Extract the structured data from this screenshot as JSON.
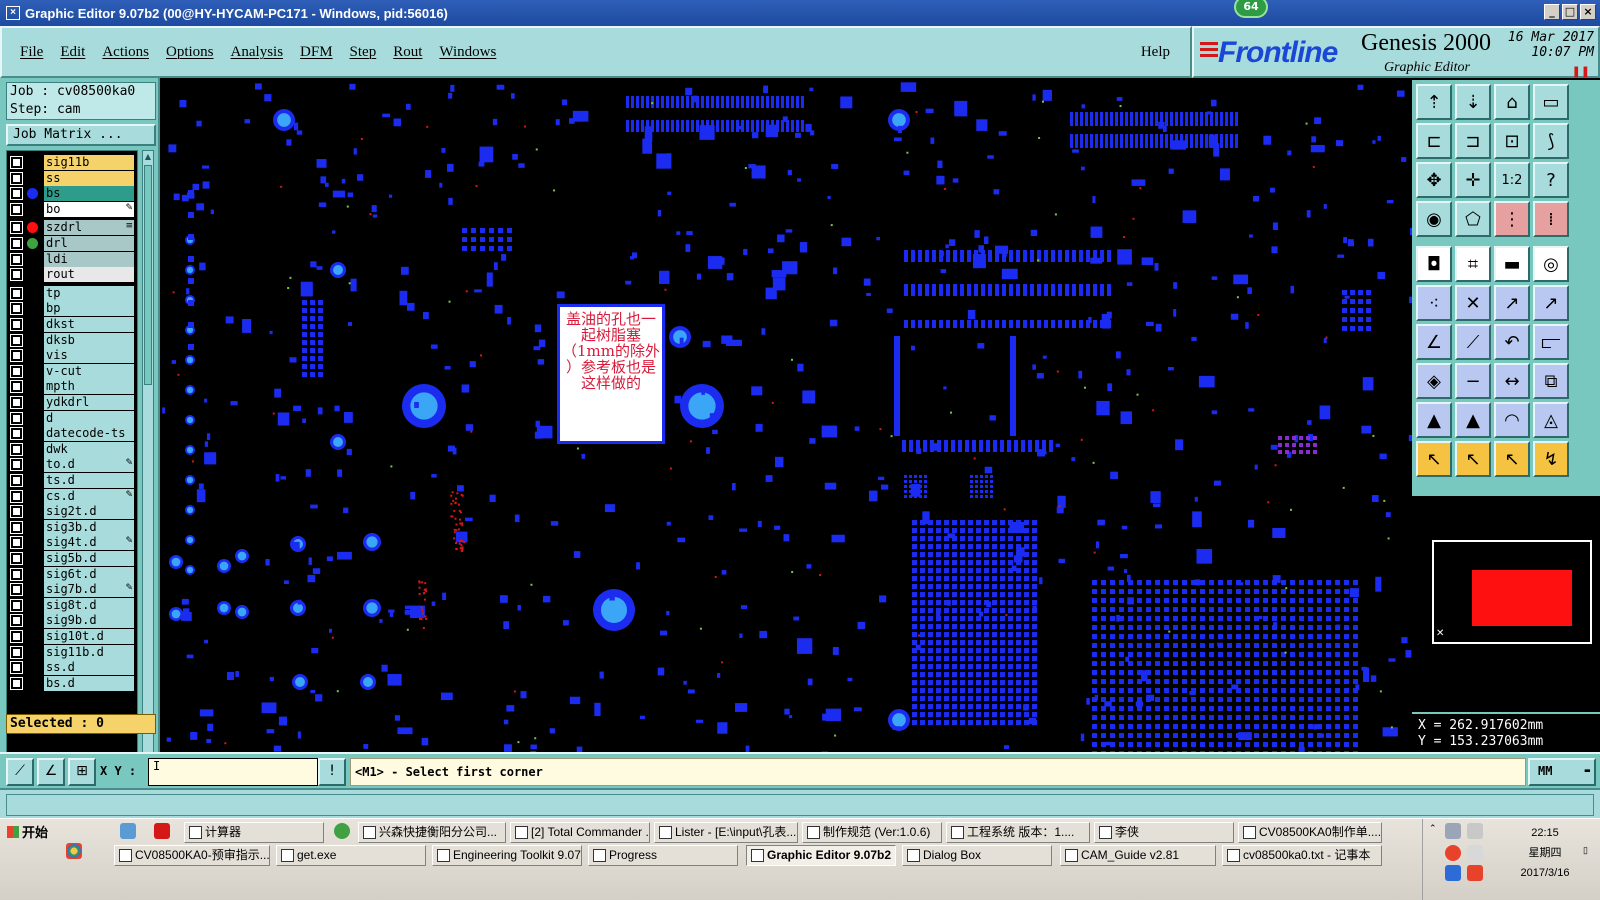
{
  "window": {
    "title": "Graphic Editor 9.07b2 (00@HY-HYCAM-PC171 - Windows, pid:56016)",
    "badge": "64"
  },
  "menu": {
    "items": [
      "File",
      "Edit",
      "Actions",
      "Options",
      "Analysis",
      "DFM",
      "Step",
      "Rout",
      "Windows"
    ],
    "help": "Help"
  },
  "brand": {
    "logo": "Frontline",
    "product": "Genesis 2000",
    "subtitle": "Graphic Editor",
    "date": "16 Mar 2017",
    "time": "10:07 PM",
    "pause_icon": "pause-icon"
  },
  "job": {
    "job_line": "Job : cv08500ka0",
    "step_line": "Step: cam",
    "matrix_button": "Job Matrix ..."
  },
  "layers": [
    {
      "name": "sig11b",
      "color": "#f5d36a",
      "dot": "",
      "flag": ""
    },
    {
      "name": "ss",
      "color": "#f5d36a",
      "dot": "",
      "flag": ""
    },
    {
      "name": "bs",
      "color": "#2e9c8a",
      "dot": "#1b2cf0",
      "flag": ""
    },
    {
      "name": "bo",
      "color": "#ffffff",
      "dot": "",
      "flag": "✎"
    },
    {
      "name": "szdrl",
      "color": "#a8c8c8",
      "dot": "#ff1010",
      "flag": "≡"
    },
    {
      "name": "drl",
      "color": "#a8c8c8",
      "dot": "#3fa142",
      "flag": ""
    },
    {
      "name": "ldi",
      "color": "#a8c8c8",
      "dot": "",
      "flag": ""
    },
    {
      "name": "rout",
      "color": "#e8e8e8",
      "dot": "",
      "flag": ""
    },
    {
      "name": "tp",
      "color": "#a8dcdc",
      "dot": "",
      "flag": ""
    },
    {
      "name": "bp",
      "color": "#a8dcdc",
      "dot": "",
      "flag": ""
    },
    {
      "name": "dkst",
      "color": "#a8dcdc",
      "dot": "",
      "flag": ""
    },
    {
      "name": "dksb",
      "color": "#a8dcdc",
      "dot": "",
      "flag": ""
    },
    {
      "name": "vis",
      "color": "#a8dcdc",
      "dot": "",
      "flag": ""
    },
    {
      "name": "v-cut",
      "color": "#a8dcdc",
      "dot": "",
      "flag": ""
    },
    {
      "name": "mpth",
      "color": "#a8dcdc",
      "dot": "",
      "flag": ""
    },
    {
      "name": "ydkdrl",
      "color": "#a8dcdc",
      "dot": "",
      "flag": ""
    },
    {
      "name": "d",
      "color": "#a8dcdc",
      "dot": "",
      "flag": ""
    },
    {
      "name": "datecode-ts",
      "color": "#a8dcdc",
      "dot": "",
      "flag": ""
    },
    {
      "name": "dwk",
      "color": "#a8dcdc",
      "dot": "",
      "flag": ""
    },
    {
      "name": "to.d",
      "color": "#a8dcdc",
      "dot": "",
      "flag": "✎"
    },
    {
      "name": "ts.d",
      "color": "#a8dcdc",
      "dot": "",
      "flag": ""
    },
    {
      "name": "cs.d",
      "color": "#a8dcdc",
      "dot": "",
      "flag": "✎"
    },
    {
      "name": "sig2t.d",
      "color": "#a8dcdc",
      "dot": "",
      "flag": ""
    },
    {
      "name": "sig3b.d",
      "color": "#a8dcdc",
      "dot": "",
      "flag": ""
    },
    {
      "name": "sig4t.d",
      "color": "#a8dcdc",
      "dot": "",
      "flag": "✎"
    },
    {
      "name": "sig5b.d",
      "color": "#a8dcdc",
      "dot": "",
      "flag": ""
    },
    {
      "name": "sig6t.d",
      "color": "#a8dcdc",
      "dot": "",
      "flag": ""
    },
    {
      "name": "sig7b.d",
      "color": "#a8dcdc",
      "dot": "",
      "flag": "✎"
    },
    {
      "name": "sig8t.d",
      "color": "#a8dcdc",
      "dot": "",
      "flag": ""
    },
    {
      "name": "sig9b.d",
      "color": "#a8dcdc",
      "dot": "",
      "flag": ""
    },
    {
      "name": "sig10t.d",
      "color": "#a8dcdc",
      "dot": "",
      "flag": ""
    },
    {
      "name": "sig11b.d",
      "color": "#a8dcdc",
      "dot": "",
      "flag": ""
    },
    {
      "name": "ss.d",
      "color": "#a8dcdc",
      "dot": "",
      "flag": ""
    },
    {
      "name": "bs.d",
      "color": "#a8dcdc",
      "dot": "",
      "flag": ""
    }
  ],
  "selected": "Selected : 0",
  "canvas_note": {
    "lines": [
      "盖油的孔也一",
      "起树脂塞",
      "（1mm的除外",
      "）参考板也是",
      "这样做的"
    ]
  },
  "coords": {
    "x": "X = 262.917602mm",
    "y": "Y = 153.237063mm"
  },
  "command": {
    "xy_label": "X Y :",
    "xy_value": "I",
    "message": "<M1> - Select first corner",
    "unit": "MM",
    "info_icon": "!"
  },
  "right_tools": [
    "layer-up-icon",
    "layer-down-icon",
    "home-icon",
    "window-icon",
    "zoom-in-icon",
    "zoom-out-icon",
    "fit-icon",
    "snap-icon",
    "pan-icon",
    "center-icon",
    "scale-1-2-icon",
    "help-icon",
    "measure-icon",
    "probe-icon",
    "select-net-icon",
    "select-sym-icon",
    "camera-icon",
    "drc-icon",
    "ruler-icon",
    "target-icon",
    "connect-icon",
    "cut-icon",
    "line-icon",
    "move-icon",
    "draw-line-icon",
    "draw-slant-icon",
    "undo-icon",
    "split-icon",
    "pad-icon",
    "minus-icon",
    "dimension-icon",
    "array-icon",
    "text-icon",
    "arrow-up-icon",
    "arc-icon",
    "fillet-icon",
    "pointer-icon",
    "select-icon",
    "highlight-icon",
    "route-icon"
  ],
  "taskbar": {
    "start": "开始",
    "row1": [
      {
        "label": "计算器",
        "icon": "calc-icon"
      },
      {
        "label": "兴森快捷衡阳分公司...",
        "icon": "browser-icon"
      },
      {
        "label": "[2] Total Commander ...",
        "icon": "commander-icon"
      },
      {
        "label": "Lister - [E:\\input\\孔表...",
        "icon": "lister-icon"
      },
      {
        "label": "制作规范 (Ver:1.0.6)",
        "icon": "doc-icon"
      },
      {
        "label": "工程系统  版本：1....",
        "icon": "system-icon"
      },
      {
        "label": "李侠",
        "icon": "chat-icon"
      },
      {
        "label": "CV08500KA0制作单....",
        "icon": "form-icon"
      }
    ],
    "row2": [
      {
        "label": "CV08500KA0-预审指示....",
        "icon": "form-icon"
      },
      {
        "label": "get.exe",
        "icon": "exe-icon"
      },
      {
        "label": "Engineering Toolkit 9.07...",
        "icon": "toolkit-icon"
      },
      {
        "label": "Progress",
        "icon": "progress-icon"
      },
      {
        "label": "Graphic Editor 9.07b2 ...",
        "icon": "editor-icon",
        "active": true
      },
      {
        "label": "Dialog Box",
        "icon": "dialog-icon"
      },
      {
        "label": "CAM_Guide v2.81",
        "icon": "guide-icon"
      },
      {
        "label": "cv08500ka0.txt - 记事本",
        "icon": "notepad-icon"
      }
    ],
    "clock_time": "22:15",
    "clock_day": "星期四",
    "clock_date": "2017/3/16"
  }
}
